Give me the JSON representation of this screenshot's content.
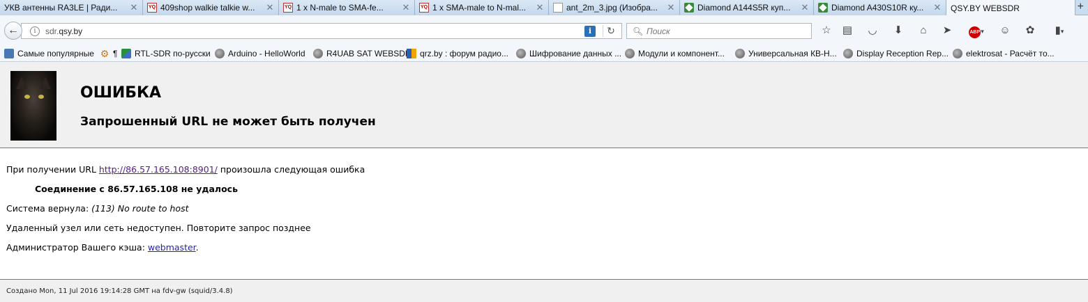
{
  "tabs": [
    {
      "title": "УКВ антенны RA3LE | Ради...",
      "icon": "none"
    },
    {
      "title": "409shop walkie talkie w...",
      "icon": "radio-shop-icon"
    },
    {
      "title": "1 x N-male to SMA-fe...",
      "icon": "radio-shop-icon"
    },
    {
      "title": "1 x SMA-male to N-mal...",
      "icon": "radio-shop-icon"
    },
    {
      "title": "ant_2m_3.jpg (Изобра...",
      "icon": "page-icon"
    },
    {
      "title": "Diamond A144S5R куп...",
      "icon": "diamond-icon"
    },
    {
      "title": "Diamond A430S10R ку...",
      "icon": "diamond-icon"
    },
    {
      "title": "QSY.BY WEBSDR",
      "icon": "none"
    }
  ],
  "address": {
    "prefix": "sdr.",
    "domain": "qsy.by"
  },
  "search": {
    "placeholder": "Поиск"
  },
  "bookmarks": [
    {
      "label": "Самые популярные",
      "icon": "star-icon"
    },
    {
      "label": "¶",
      "icon": "gear-icon"
    },
    {
      "label": "RTL-SDR по-русски",
      "icon": "rtlsdr-icon"
    },
    {
      "label": "Arduino - HelloWorld",
      "icon": "globe-icon"
    },
    {
      "label": "R4UAB SAT WEBSDR",
      "icon": "globe-icon"
    },
    {
      "label": "qrz.by : форум радио...",
      "icon": "qrz-icon"
    },
    {
      "label": "Шифрование данных ...",
      "icon": "globe-icon"
    },
    {
      "label": "Модули и компонент...",
      "icon": "globe-icon"
    },
    {
      "label": "Универсальная КВ-Н...",
      "icon": "globe-icon"
    },
    {
      "label": "Display Reception Rep...",
      "icon": "globe-icon"
    },
    {
      "label": "elektrosat - Расчёт то...",
      "icon": "globe-icon"
    }
  ],
  "error": {
    "title": "ОШИБКА",
    "subtitle": "Запрошенный URL не может быть получен",
    "line1_pre": "При получении URL ",
    "line1_url": "http://86.57.165.108:8901/",
    "line1_post": " произошла следующая ошибка",
    "connection": "Соединение с 86.57.165.108 не удалось",
    "system_pre": "Система вернула: ",
    "system_msg": "(113) No route to host",
    "unreachable": "Удаленный узел или сеть недоступен. Повторите запрос позднее",
    "admin_pre": "Администратор Вашего кэша: ",
    "admin_link": "webmaster",
    "admin_post": "."
  },
  "footer": "Создано Mon, 11 Jul 2016 19:14:28 GMT на fdv-gw (squid/3.4.8)"
}
